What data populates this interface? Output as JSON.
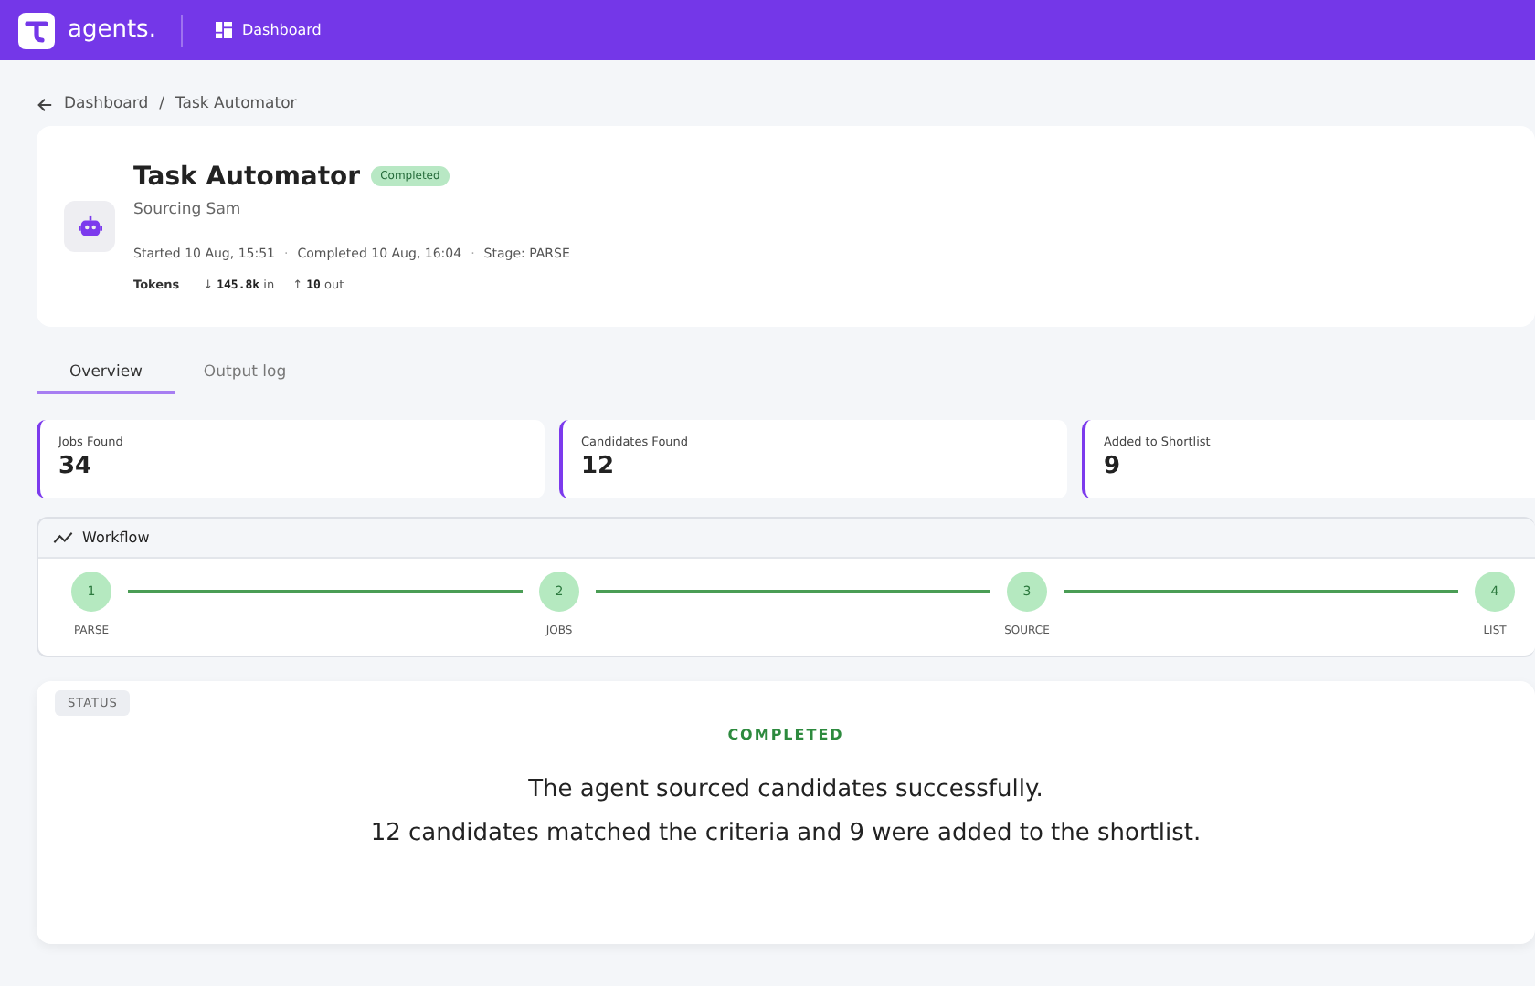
{
  "header": {
    "logo": "agents.",
    "nav": "Dashboard"
  },
  "breadcrumb": [
    "Dashboard",
    "Task Automator"
  ],
  "breadcrumb_separator": "/",
  "task": {
    "title": "Task Automator",
    "badge": "Completed",
    "agent": "Sourcing Sam",
    "meta": [
      "Started 10 Aug, 15:51",
      "Completed 10 Aug, 16:04",
      "Stage: PARSE"
    ],
    "meta_separator": "·",
    "tokens_label": "Tokens",
    "in_arrow": "↓",
    "tokens_in": "145.8k",
    "in_label": "in",
    "out_arrow": "↑",
    "tokens_out": "10",
    "out_label": "out"
  },
  "tabs": [
    {
      "label": "Overview",
      "selected": true
    },
    {
      "label": "Output log",
      "selected": false
    }
  ],
  "stats": [
    {
      "label": "Jobs Found",
      "value": "34"
    },
    {
      "label": "Candidates Found",
      "value": "12"
    },
    {
      "label": "Added to Shortlist",
      "value": "9"
    }
  ],
  "workflow": {
    "title": "Workflow",
    "steps": [
      {
        "number": "1",
        "label": "PARSE",
        "done": true
      },
      {
        "number": "2",
        "label": "JOBS",
        "done": true
      },
      {
        "number": "3",
        "label": "SOURCE",
        "done": true
      },
      {
        "number": "4",
        "label": "LIST",
        "done": true
      }
    ]
  },
  "status": {
    "tag": "STATUS",
    "state": "COMPLETED",
    "lines": [
      "The agent sourced candidates successfully.",
      "12 candidates matched the criteria and 9 were added to the shortlist."
    ]
  }
}
